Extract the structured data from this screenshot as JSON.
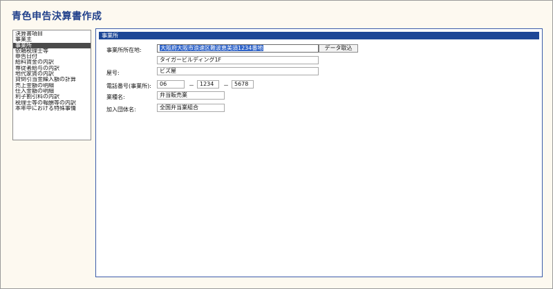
{
  "app": {
    "title": "青色申告決算書作成"
  },
  "sidebar": {
    "items": [
      "決算書項目",
      "事業主",
      "事業所",
      "依頼税理士等",
      "申告日付",
      "給料賃金の内訳",
      "専従者給与の内訳",
      "地代家賃の内訳",
      "貸倒引当金繰入額の計算",
      "売上金額の明細",
      "仕入金額の明細",
      "利子割引料の内訳",
      "税理士等の報酬等の内訳",
      "本年中における特殊事情"
    ],
    "selected_index": 2
  },
  "panel": {
    "title": "事業所",
    "address_label": "事業所所在地:",
    "address_line1": "大阪府大阪市浪速区難波恵美須1234番地",
    "address_line2": "タイガービルディング1F",
    "import_button": "データ取込",
    "shop_name_label": "屋号:",
    "shop_name": "ビズ屋",
    "phone_label": "電話番号(事業所):",
    "phone_1": "06",
    "phone_2": "1234",
    "phone_3": "5678",
    "phone_sep": "－",
    "industry_label": "業種名:",
    "industry": "弁当販売業",
    "association_label": "加入団体名:",
    "association": "全国弁当業組合"
  }
}
